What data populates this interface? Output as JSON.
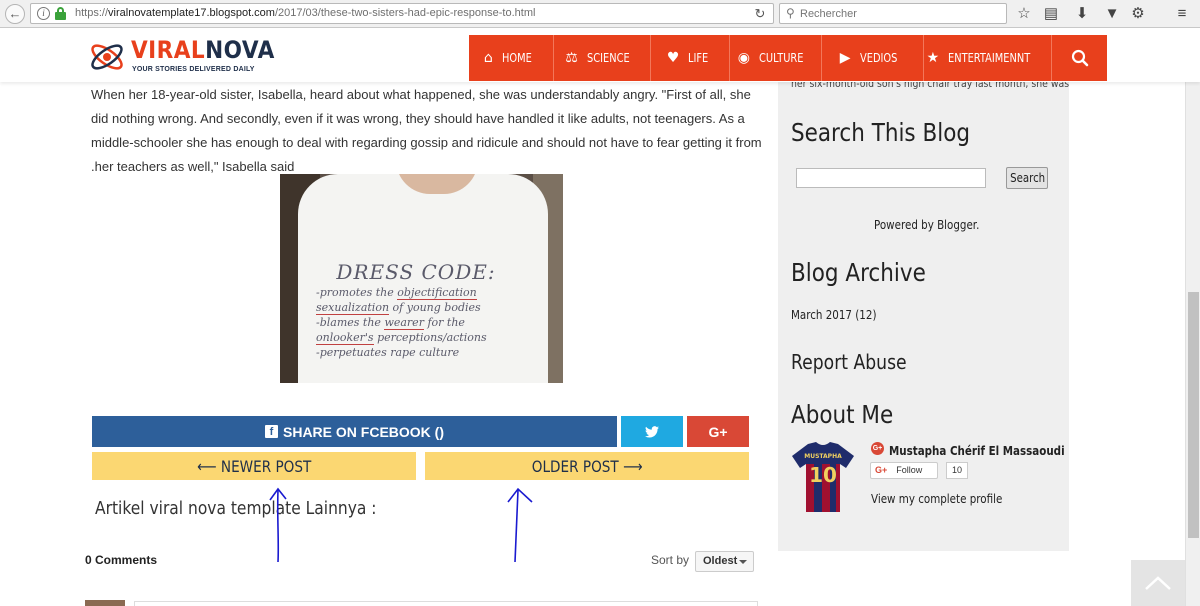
{
  "browser": {
    "url_prefix": "https://",
    "url_domain": "viralnovatemplate17.blogspot.com",
    "url_path": "/2017/03/these-two-sisters-had-epic-response-to.html",
    "search_placeholder": "Rechercher"
  },
  "site": {
    "logo_viral": "VIRAL",
    "logo_nova": "NOVA",
    "tagline": "YOUR STORIES DELIVERED DAILY",
    "brand_color": "#e8401c"
  },
  "nav": [
    {
      "label": "HOME",
      "icon": "home-icon"
    },
    {
      "label": "SCIENCE",
      "icon": "flask-icon"
    },
    {
      "label": "LIFE",
      "icon": "heart-icon"
    },
    {
      "label": "CULTURE",
      "icon": "globe-icon"
    },
    {
      "label": "VEDIOS",
      "icon": "video-icon"
    },
    {
      "label": "ENTERTAIMENNT",
      "icon": "star-icon"
    }
  ],
  "article": {
    "paragraph": "When her 18-year-old sister, Isabella, heard about what happened, she was understandably angry. \"First of all, she did nothing wrong. And secondly, even if it was wrong, they should have handled it like adults, not teenagers. As a middle-schooler she has enough to deal with regarding gossip and ridicule and should not have to fear getting it from .her teachers as well,\" Isabella said",
    "shirt": {
      "title": "DRESS CODE:",
      "line1_a": "-promotes the ",
      "line1_b": "objectification",
      "line2_a": "sexualization",
      "line2_b": " of young bodies",
      "line3_a": "-blames the ",
      "line3_b": "wearer",
      "line3_c": " for the",
      "line4_a": "onlooker's",
      "line4_b": " perceptions/actions",
      "line5": "-perpetuates rape culture"
    }
  },
  "share": {
    "facebook_label": "SHARE ON FCEBOOK ()",
    "gplus_label": "G+"
  },
  "post_nav": {
    "newer": "⟵ NEWER POST",
    "older": "OLDER POST ⟶"
  },
  "related_title": "Artikel viral nova template Lainnya :",
  "comments": {
    "title": "0 Comments",
    "sort_label": "Sort by",
    "sort_value": "Oldest"
  },
  "sidebar": {
    "clipped_text": "her six-month-old son's high chair tray last month, she was",
    "search_heading": "Search This Blog",
    "search_button": "Search",
    "powered_by": "Powered by Blogger.",
    "archive_heading": "Blog Archive",
    "archive_item": "March 2017 (12)",
    "report_heading": "Report Abuse",
    "about_heading": "About Me",
    "profile_name": "Mustapha Chérif El Massaoudi",
    "follow_label": "Follow",
    "follow_count": "10",
    "profile_link": "View my complete profile",
    "jersey_name": "MUSTAPHA",
    "jersey_number": "10"
  }
}
